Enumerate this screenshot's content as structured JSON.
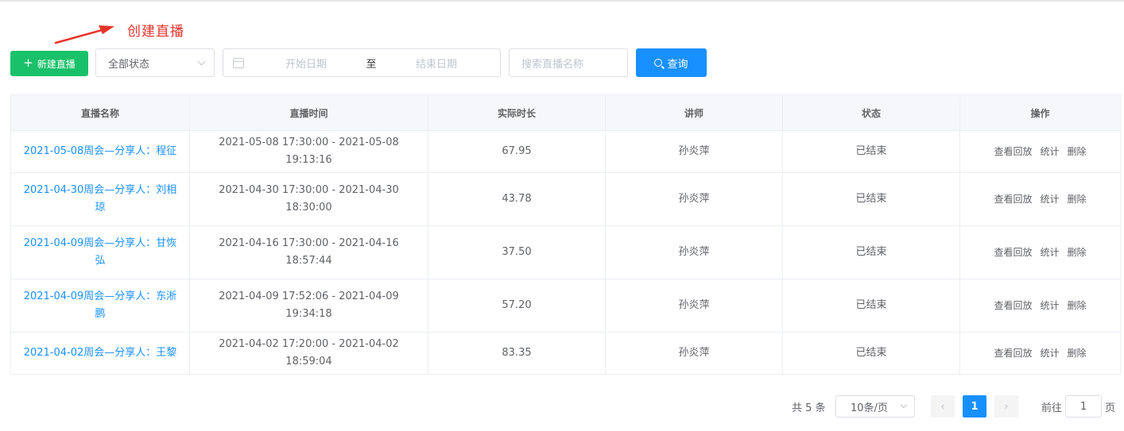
{
  "annotation": {
    "text": "创建直播"
  },
  "toolbar": {
    "create_label": "新建直播",
    "status_value": "全部状态",
    "date_start_placeholder": "开始日期",
    "date_separator": "至",
    "date_end_placeholder": "结束日期",
    "search_placeholder": "搜索直播名称",
    "query_label": "查询"
  },
  "table": {
    "columns": [
      "直播名称",
      "直播时间",
      "实际时长",
      "讲师",
      "状态",
      "操作"
    ],
    "rows": [
      {
        "name": "2021-05-08周会—分享人：程征",
        "time": "2021-05-08 17:30:00 - 2021-05-08 19:13:16",
        "duration": "67.95",
        "lecturer": "孙炎萍",
        "status": "已结束"
      },
      {
        "name": "2021-04-30周会—分享人：刘相琼",
        "time": "2021-04-30 17:30:00 - 2021-04-30 18:30:00",
        "duration": "43.78",
        "lecturer": "孙炎萍",
        "status": "已结束"
      },
      {
        "name": "2021-04-09周会—分享人：甘恢弘",
        "time": "2021-04-16 17:30:00 - 2021-04-16 18:57:44",
        "duration": "37.50",
        "lecturer": "孙炎萍",
        "status": "已结束"
      },
      {
        "name": "2021-04-09周会—分享人：东淅鹏",
        "time": "2021-04-09 17:52:06 - 2021-04-09 19:34:18",
        "duration": "57.20",
        "lecturer": "孙炎萍",
        "status": "已结束"
      },
      {
        "name": "2021-04-02周会—分享人：王黎",
        "time": "2021-04-02 17:20:00 - 2021-04-02 18:59:04",
        "duration": "83.35",
        "lecturer": "孙炎萍",
        "status": "已结束"
      }
    ],
    "actions": [
      "查看回放",
      "统计",
      "删除"
    ]
  },
  "pagination": {
    "total_text": "共 5 条",
    "page_size": "10条/页",
    "prev_symbol": "‹",
    "current_page": "1",
    "next_symbol": "›",
    "goto_label": "前往",
    "goto_value": "1",
    "page_unit": "页"
  },
  "colors": {
    "primary": "#1890ff",
    "create": "#19c16a",
    "annotation": "#e8332a"
  }
}
